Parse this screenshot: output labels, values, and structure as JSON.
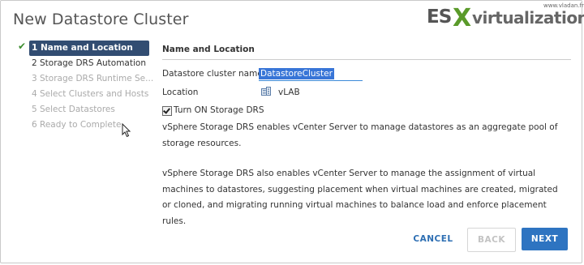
{
  "dialog": {
    "title": "New Datastore Cluster"
  },
  "watermark": {
    "site": "www.vladan.fr",
    "brand_es": "ES",
    "brand_x": "X",
    "brand_rest": "virtualization"
  },
  "steps": [
    {
      "label": "1 Name and Location",
      "state": "active",
      "completed": true
    },
    {
      "label": "2 Storage DRS Automation",
      "state": "enabled"
    },
    {
      "label": "3 Storage DRS Runtime Se...",
      "state": "disabled"
    },
    {
      "label": "4 Select Clusters and Hosts",
      "state": "disabled"
    },
    {
      "label": "5 Select Datastores",
      "state": "disabled"
    },
    {
      "label": "6 Ready to Complete",
      "state": "disabled"
    }
  ],
  "main": {
    "section_title": "Name and Location",
    "cluster_name_label": "Datastore cluster name:",
    "cluster_name_value": "DatastoreCluster",
    "location_label": "Location",
    "location_value": "vLAB",
    "storage_drs_checkbox_label": "Turn ON Storage DRS",
    "storage_drs_checked": true,
    "description_1": "vSphere Storage DRS enables vCenter Server to manage datastores as an aggregate pool of storage resources.",
    "description_2": "vSphere Storage DRS also enables vCenter Server to manage the assignment of virtual machines to datastores, suggesting placement when virtual machines are created, migrated or cloned, and migrating running virtual machines to balance load and enforce placement rules."
  },
  "buttons": {
    "cancel": "CANCEL",
    "back": "BACK",
    "next": "NEXT"
  },
  "colors": {
    "active_step_bg": "#324d72",
    "check": "#3c8d2f",
    "primary": "#2e74c1",
    "link": "#2e6fb3"
  },
  "icons": {
    "completed_step": "check-icon",
    "location": "datacenter-icon",
    "pointer": "mouse-cursor-icon"
  }
}
